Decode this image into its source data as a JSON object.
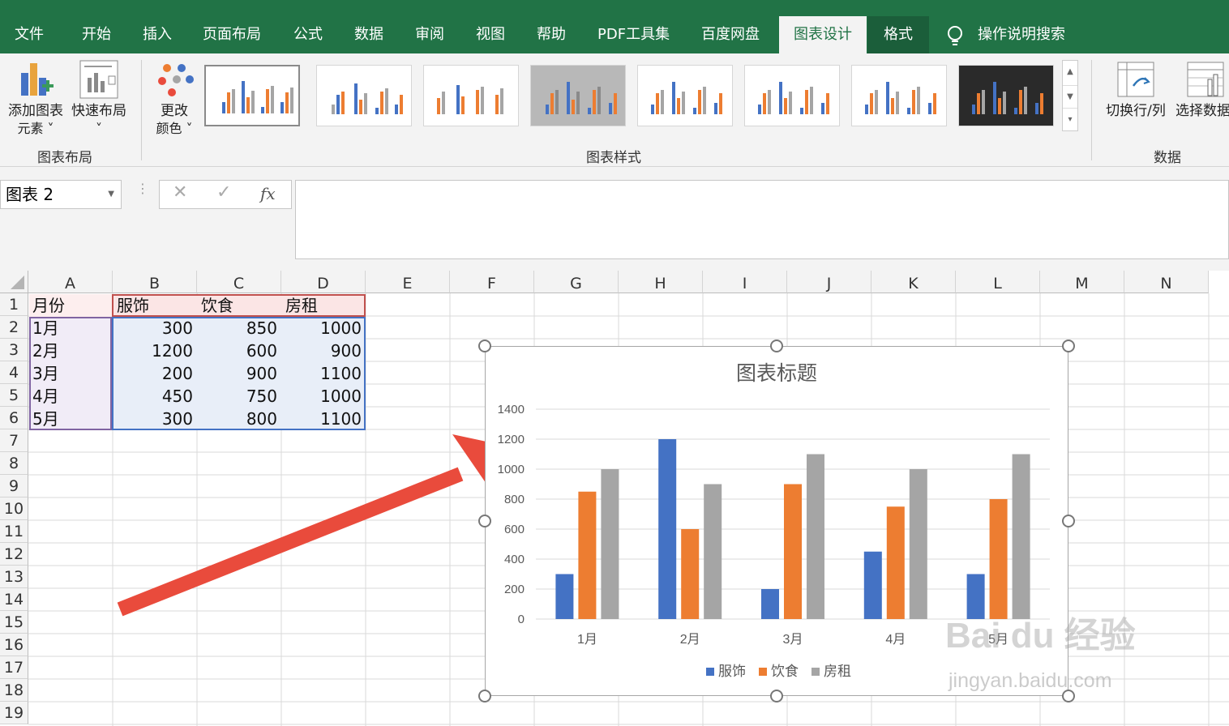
{
  "ribbon": {
    "tabs": [
      "文件",
      "开始",
      "插入",
      "页面布局",
      "公式",
      "数据",
      "审阅",
      "视图",
      "帮助",
      "PDF工具集",
      "百度网盘",
      "图表设计",
      "格式"
    ],
    "active_tab": "图表设计",
    "tell_me": "操作说明搜索",
    "groups": {
      "chart_layouts": {
        "label": "图表布局",
        "add_element": [
          "添加图表",
          "元素 ˅"
        ],
        "quick_layout": [
          "快速布局",
          "˅"
        ]
      },
      "chart_styles": {
        "label": "图表样式",
        "change_colors": [
          "更改",
          "颜色 ˅"
        ]
      },
      "data": {
        "label": "数据",
        "switch_row_col": "切换行/列",
        "select_data": "选择数据"
      }
    }
  },
  "formula_bar": {
    "name_box": "图表 2",
    "cancel": "✕",
    "enter": "✓",
    "fx": "fx",
    "formula": ""
  },
  "sheet": {
    "columns": [
      "A",
      "B",
      "C",
      "D",
      "E",
      "F",
      "G",
      "H",
      "I",
      "J",
      "K",
      "L",
      "M",
      "N"
    ],
    "rows": [
      "1",
      "2",
      "3",
      "4",
      "5",
      "6",
      "7",
      "8",
      "9",
      "10",
      "11",
      "12",
      "13",
      "14",
      "15",
      "16",
      "17",
      "18",
      "19"
    ],
    "header": [
      "月份",
      "服饰",
      "饮食",
      "房租"
    ],
    "data": [
      [
        "1月",
        "300",
        "850",
        "1000"
      ],
      [
        "2月",
        "1200",
        "600",
        "900"
      ],
      [
        "3月",
        "200",
        "900",
        "1100"
      ],
      [
        "4月",
        "450",
        "750",
        "1000"
      ],
      [
        "5月",
        "300",
        "800",
        "1100"
      ]
    ]
  },
  "colors": {
    "ribbon_green": "#217346",
    "series1": "#4472C4",
    "series2": "#ED7D31",
    "series3": "#A5A5A5",
    "arrow": "#E94B3C"
  },
  "chart_data": {
    "type": "bar",
    "title": "图表标题",
    "categories": [
      "1月",
      "2月",
      "3月",
      "4月",
      "5月"
    ],
    "series": [
      {
        "name": "服饰",
        "values": [
          300,
          1200,
          200,
          450,
          300
        ]
      },
      {
        "name": "饮食",
        "values": [
          850,
          600,
          900,
          750,
          800
        ]
      },
      {
        "name": "房租",
        "values": [
          1000,
          900,
          1100,
          1000,
          1100
        ]
      }
    ],
    "yticks": [
      "0",
      "200",
      "400",
      "600",
      "800",
      "1000",
      "1200",
      "1400"
    ],
    "ylim": [
      0,
      1400
    ],
    "grid": true,
    "legend": "bottom"
  },
  "watermark": {
    "brand": "Bai du 经验",
    "url": "jingyan.baidu.com"
  }
}
